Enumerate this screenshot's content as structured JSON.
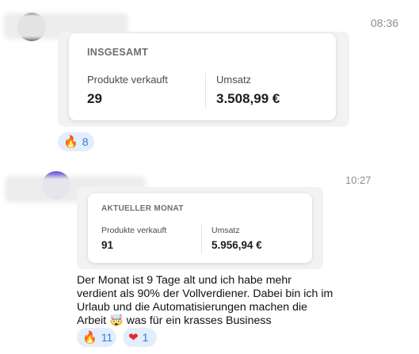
{
  "message1": {
    "time": "08:36",
    "card": {
      "title": "INSGESAMT",
      "left_label": "Produkte verkauft",
      "left_value": "29",
      "right_label": "Umsatz",
      "right_value": "3.508,99 €"
    },
    "reactions": [
      {
        "emoji": "🔥",
        "icon": "fire-icon",
        "count": "8"
      }
    ]
  },
  "message2": {
    "time": "10:27",
    "card": {
      "title": "AKTUELLER MONAT",
      "left_label": "Produkte verkauft",
      "left_value": "91",
      "right_label": "Umsatz",
      "right_value": "5.956,94 €"
    },
    "text": "Der Monat ist 9 Tage alt und ich habe mehr\nverdient als 90% der Vollverdiener. Dabei bin ich im\nUrlaub und die Automatisierungen machen die\nArbeit 🤯 was für ein krasses Business",
    "reactions": [
      {
        "emoji": "🔥",
        "icon": "fire-icon",
        "count": "11"
      },
      {
        "emoji": "❤",
        "icon": "heart-icon",
        "count": "1"
      }
    ]
  },
  "colors": {
    "accent": "#3478e5",
    "reaction_bg": "#e3eefc",
    "bubble_bg": "#f2f2f4"
  }
}
